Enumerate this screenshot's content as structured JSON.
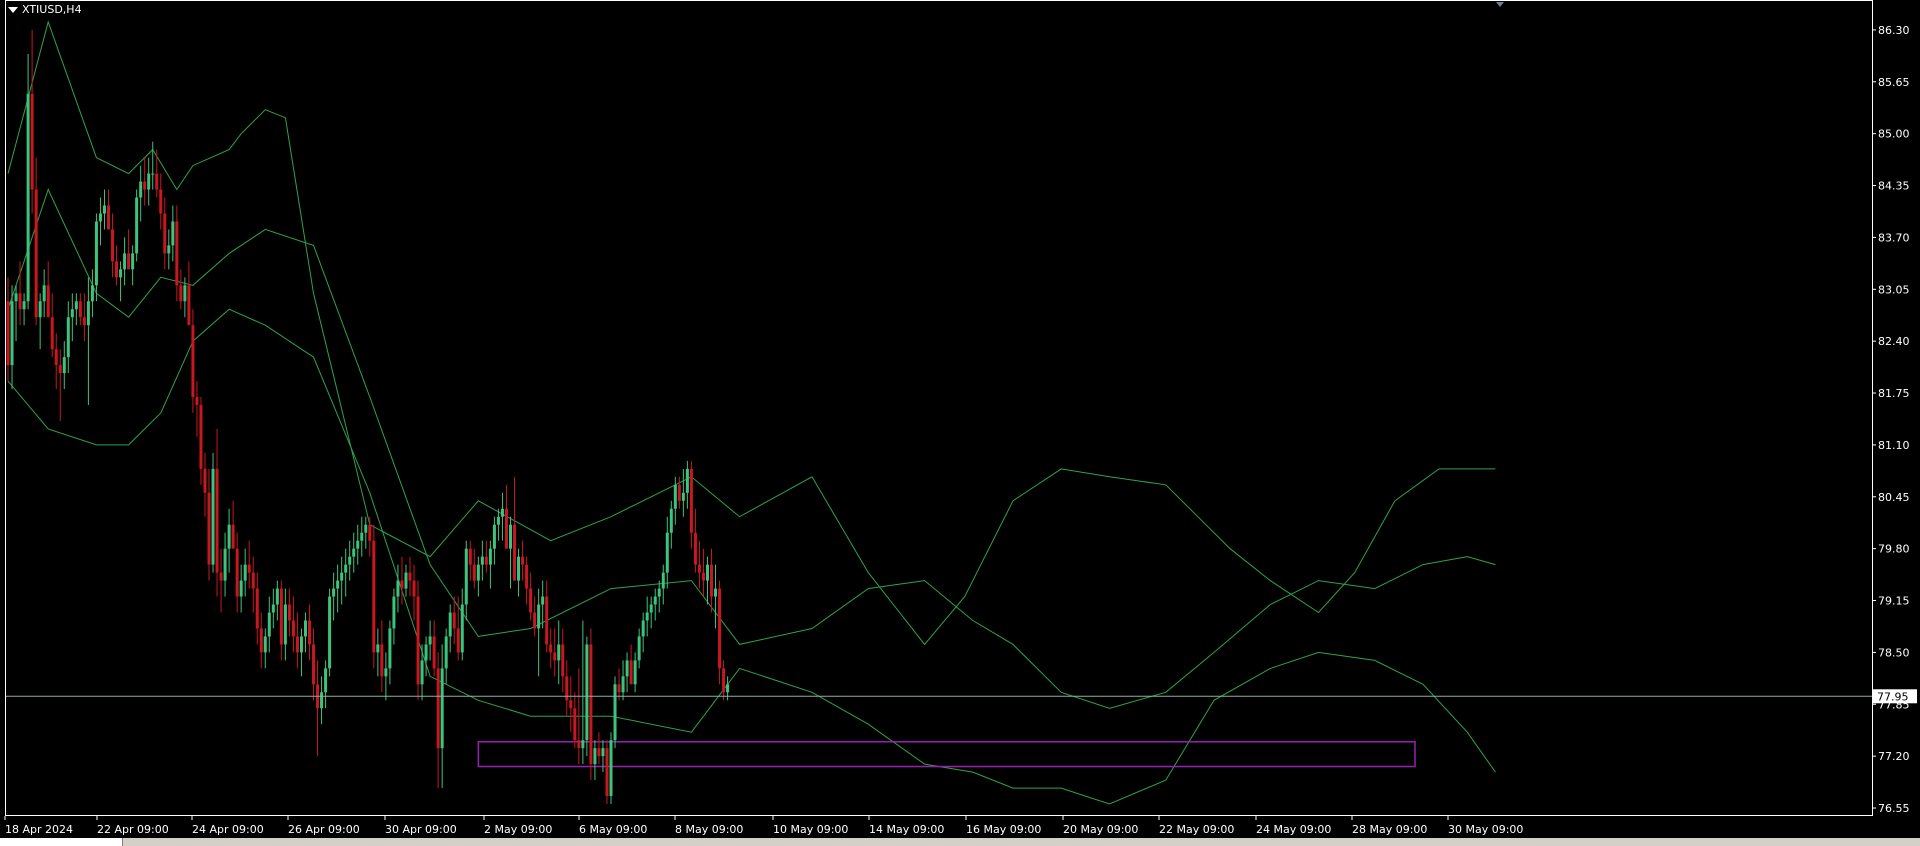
{
  "window": {
    "symbol_title": "XTIUSD,H4"
  },
  "colors": {
    "background": "#000000",
    "frame": "#ffffff",
    "bull": "#3cc47e",
    "bear": "#c8171e",
    "bands": "#2fa34b",
    "price_line": "#8fb0a8",
    "zone": "#9a1fb5",
    "text": "#ffffff"
  },
  "chart_data": {
    "type": "candlestick",
    "symbol": "XTIUSD",
    "timeframe": "H4",
    "x_tick_labels": [
      "18 Apr 2024",
      "22 Apr 09:00",
      "24 Apr 09:00",
      "26 Apr 09:00",
      "30 Apr 09:00",
      "2 May 09:00",
      "6 May 09:00",
      "8 May 09:00",
      "10 May 09:00",
      "14 May 09:00",
      "16 May 09:00",
      "20 May 09:00",
      "22 May 09:00",
      "24 May 09:00",
      "28 May 09:00",
      "30 May 09:00"
    ],
    "y_ticks": [
      86.3,
      85.65,
      85.0,
      84.35,
      83.7,
      83.05,
      82.4,
      81.75,
      81.1,
      80.45,
      79.8,
      79.15,
      78.5,
      77.85,
      77.2,
      76.55
    ],
    "ylim": [
      76.45,
      86.65
    ],
    "current_price": 77.95,
    "current_price_label": "77.95",
    "support_zone": {
      "from_bar": 117,
      "to_bar": 350,
      "low": 77.07,
      "high": 77.38
    },
    "candles": [
      [
        82.9,
        83.2,
        81.9,
        82.1
      ],
      [
        82.1,
        83.1,
        81.8,
        82.9
      ],
      [
        82.9,
        83.1,
        82.4,
        83.0
      ],
      [
        83.0,
        83.4,
        82.6,
        82.8
      ],
      [
        82.8,
        83.0,
        82.6,
        82.9
      ],
      [
        82.9,
        86.0,
        82.8,
        85.5
      ],
      [
        85.5,
        86.3,
        84.0,
        84.3
      ],
      [
        84.3,
        84.7,
        82.6,
        82.7
      ],
      [
        82.7,
        83.0,
        82.3,
        82.9
      ],
      [
        82.9,
        83.3,
        82.7,
        83.1
      ],
      [
        83.1,
        83.4,
        82.8,
        82.7
      ],
      [
        82.7,
        83.0,
        82.2,
        82.3
      ],
      [
        82.3,
        82.5,
        81.8,
        82.1
      ],
      [
        82.1,
        82.3,
        81.4,
        82.0
      ],
      [
        82.0,
        82.4,
        81.8,
        82.2
      ],
      [
        82.2,
        82.9,
        82.0,
        82.7
      ],
      [
        82.7,
        83.0,
        82.4,
        82.8
      ],
      [
        82.8,
        83.0,
        82.6,
        82.9
      ],
      [
        82.9,
        83.0,
        82.6,
        82.7
      ],
      [
        82.7,
        83.0,
        82.4,
        82.6
      ],
      [
        82.6,
        83.2,
        81.6,
        82.9
      ],
      [
        82.9,
        83.3,
        82.7,
        83.1
      ],
      [
        83.1,
        84.0,
        82.9,
        83.9
      ],
      [
        83.9,
        84.2,
        83.6,
        84.0
      ],
      [
        84.0,
        84.3,
        83.8,
        84.1
      ],
      [
        84.1,
        84.3,
        83.8,
        83.8
      ],
      [
        83.8,
        84.0,
        83.2,
        83.4
      ],
      [
        83.4,
        83.6,
        83.1,
        83.2
      ],
      [
        83.2,
        83.4,
        82.9,
        83.3
      ],
      [
        83.3,
        83.7,
        83.1,
        83.5
      ],
      [
        83.5,
        83.8,
        83.3,
        83.3
      ],
      [
        83.3,
        83.6,
        83.1,
        83.5
      ],
      [
        83.5,
        84.3,
        83.4,
        84.2
      ],
      [
        84.2,
        84.6,
        83.9,
        84.4
      ],
      [
        84.4,
        84.7,
        84.1,
        84.3
      ],
      [
        84.3,
        84.7,
        84.1,
        84.5
      ],
      [
        84.5,
        84.9,
        84.3,
        84.5
      ],
      [
        84.5,
        84.8,
        84.2,
        84.3
      ],
      [
        84.3,
        84.5,
        83.8,
        84.0
      ],
      [
        84.0,
        84.2,
        83.3,
        83.5
      ],
      [
        83.5,
        83.8,
        83.3,
        83.6
      ],
      [
        83.6,
        84.1,
        83.4,
        83.9
      ],
      [
        83.9,
        84.1,
        82.9,
        83.1
      ],
      [
        83.1,
        83.3,
        82.8,
        82.9
      ],
      [
        82.9,
        83.2,
        82.7,
        83.1
      ],
      [
        83.1,
        83.4,
        82.8,
        82.6
      ],
      [
        82.6,
        82.8,
        81.5,
        81.7
      ],
      [
        81.7,
        81.9,
        81.2,
        81.6
      ],
      [
        81.6,
        81.7,
        80.6,
        80.8
      ],
      [
        80.8,
        81.0,
        80.2,
        80.5
      ],
      [
        80.5,
        80.8,
        79.4,
        79.6
      ],
      [
        79.6,
        81.0,
        79.5,
        80.8
      ],
      [
        80.8,
        81.3,
        79.2,
        79.5
      ],
      [
        79.5,
        79.8,
        79.0,
        79.4
      ],
      [
        79.4,
        80.0,
        79.2,
        79.8
      ],
      [
        79.8,
        80.3,
        79.5,
        80.1
      ],
      [
        80.1,
        80.4,
        79.9,
        79.8
      ],
      [
        79.8,
        80.0,
        79.0,
        79.2
      ],
      [
        79.2,
        79.6,
        79.0,
        79.4
      ],
      [
        79.4,
        79.8,
        79.2,
        79.6
      ],
      [
        79.6,
        79.9,
        79.3,
        79.5
      ],
      [
        79.5,
        79.7,
        79.0,
        79.3
      ],
      [
        79.3,
        79.5,
        78.6,
        78.8
      ],
      [
        78.8,
        79.0,
        78.3,
        78.5
      ],
      [
        78.5,
        78.8,
        78.3,
        78.7
      ],
      [
        78.7,
        79.2,
        78.5,
        79.0
      ],
      [
        79.0,
        79.3,
        78.8,
        79.1
      ],
      [
        79.1,
        79.4,
        78.9,
        79.3
      ],
      [
        79.3,
        79.4,
        78.4,
        78.6
      ],
      [
        78.6,
        79.3,
        78.4,
        79.1
      ],
      [
        79.1,
        79.3,
        78.7,
        78.9
      ],
      [
        78.9,
        79.2,
        78.5,
        78.7
      ],
      [
        78.7,
        79.0,
        78.3,
        78.5
      ],
      [
        78.5,
        78.8,
        78.2,
        78.7
      ],
      [
        78.7,
        79.0,
        78.5,
        78.9
      ],
      [
        78.9,
        79.1,
        78.4,
        78.6
      ],
      [
        78.6,
        78.8,
        77.9,
        78.1
      ],
      [
        78.1,
        78.4,
        77.2,
        77.8
      ],
      [
        77.8,
        78.2,
        77.6,
        78.0
      ],
      [
        78.0,
        78.4,
        77.8,
        78.3
      ],
      [
        78.3,
        79.3,
        78.2,
        79.2
      ],
      [
        79.2,
        79.5,
        78.9,
        79.3
      ],
      [
        79.3,
        79.6,
        79.0,
        79.4
      ],
      [
        79.4,
        79.7,
        79.1,
        79.5
      ],
      [
        79.5,
        79.8,
        79.2,
        79.6
      ],
      [
        79.6,
        79.9,
        79.4,
        79.7
      ],
      [
        79.7,
        80.0,
        79.5,
        79.8
      ],
      [
        79.8,
        80.1,
        79.6,
        79.9
      ],
      [
        79.9,
        80.2,
        79.7,
        80.0
      ],
      [
        80.0,
        80.2,
        79.8,
        80.1
      ],
      [
        80.1,
        80.2,
        79.7,
        79.9
      ],
      [
        79.9,
        80.1,
        78.3,
        78.5
      ],
      [
        78.5,
        78.8,
        78.2,
        78.6
      ],
      [
        78.6,
        78.9,
        78.0,
        78.2
      ],
      [
        78.2,
        78.5,
        77.9,
        78.3
      ],
      [
        78.3,
        78.9,
        78.1,
        78.8
      ],
      [
        78.8,
        79.3,
        78.6,
        79.2
      ],
      [
        79.2,
        79.6,
        79.0,
        79.4
      ],
      [
        79.4,
        79.7,
        79.1,
        79.3
      ],
      [
        79.3,
        79.6,
        79.2,
        79.5
      ],
      [
        79.5,
        79.7,
        79.2,
        79.4
      ],
      [
        79.4,
        79.6,
        78.9,
        79.2
      ],
      [
        79.2,
        79.4,
        77.9,
        78.1
      ],
      [
        78.1,
        78.6,
        77.9,
        78.4
      ],
      [
        78.4,
        78.7,
        78.2,
        78.6
      ],
      [
        78.6,
        78.9,
        78.4,
        78.7
      ],
      [
        78.7,
        78.9,
        78.2,
        78.3
      ],
      [
        78.3,
        78.5,
        76.8,
        77.3
      ],
      [
        77.3,
        78.6,
        76.8,
        78.3
      ],
      [
        78.3,
        78.8,
        78.1,
        78.7
      ],
      [
        78.7,
        79.1,
        78.5,
        79.0
      ],
      [
        79.0,
        79.2,
        78.6,
        78.8
      ],
      [
        78.8,
        79.2,
        78.4,
        78.5
      ],
      [
        78.5,
        79.3,
        78.4,
        79.1
      ],
      [
        79.1,
        79.9,
        78.9,
        79.8
      ],
      [
        79.8,
        79.9,
        79.4,
        79.6
      ],
      [
        79.6,
        79.8,
        79.3,
        79.4
      ],
      [
        79.4,
        79.7,
        79.2,
        79.6
      ],
      [
        79.6,
        79.9,
        79.4,
        79.7
      ],
      [
        79.7,
        79.9,
        79.5,
        79.6
      ],
      [
        79.6,
        79.9,
        79.3,
        79.8
      ],
      [
        79.8,
        80.2,
        79.6,
        80.1
      ],
      [
        80.1,
        80.3,
        79.9,
        80.2
      ],
      [
        80.2,
        80.5,
        79.9,
        80.3
      ],
      [
        80.3,
        80.6,
        80.0,
        79.8
      ],
      [
        79.8,
        80.2,
        79.3,
        80.1
      ],
      [
        80.1,
        80.7,
        79.8,
        79.4
      ],
      [
        79.4,
        79.8,
        79.2,
        79.7
      ],
      [
        79.7,
        79.9,
        79.4,
        79.6
      ],
      [
        79.6,
        79.7,
        79.1,
        79.3
      ],
      [
        79.3,
        79.5,
        78.9,
        79.0
      ],
      [
        79.0,
        79.2,
        78.7,
        78.8
      ],
      [
        78.8,
        79.3,
        78.2,
        79.1
      ],
      [
        79.1,
        79.4,
        78.8,
        79.2
      ],
      [
        79.2,
        79.4,
        78.5,
        78.6
      ],
      [
        78.6,
        78.8,
        78.3,
        78.5
      ],
      [
        78.5,
        78.8,
        78.2,
        78.4
      ],
      [
        78.4,
        78.9,
        78.1,
        78.6
      ],
      [
        78.6,
        78.8,
        78.0,
        78.2
      ],
      [
        78.2,
        78.4,
        77.7,
        77.9
      ],
      [
        77.9,
        78.2,
        77.5,
        77.8
      ],
      [
        77.8,
        78.0,
        77.3,
        77.4
      ],
      [
        77.4,
        78.3,
        77.1,
        77.3
      ],
      [
        77.3,
        78.9,
        77.1,
        77.4
      ],
      [
        77.4,
        78.7,
        77.2,
        78.6
      ],
      [
        78.6,
        78.8,
        76.9,
        77.1
      ],
      [
        77.1,
        77.4,
        76.9,
        77.3
      ],
      [
        77.3,
        77.5,
        77.1,
        77.2
      ],
      [
        77.2,
        77.4,
        77.0,
        77.3
      ],
      [
        77.3,
        77.4,
        76.6,
        76.7
      ],
      [
        76.7,
        77.5,
        76.6,
        77.4
      ],
      [
        77.4,
        78.2,
        77.3,
        78.1
      ],
      [
        78.1,
        78.3,
        77.9,
        78.0
      ],
      [
        78.0,
        78.4,
        77.9,
        78.2
      ],
      [
        78.2,
        78.5,
        78.0,
        78.4
      ],
      [
        78.4,
        78.6,
        78.2,
        78.1
      ],
      [
        78.1,
        78.5,
        78.0,
        78.4
      ],
      [
        78.4,
        78.8,
        78.3,
        78.7
      ],
      [
        78.7,
        79.0,
        78.5,
        78.9
      ],
      [
        78.9,
        79.2,
        78.7,
        79.0
      ],
      [
        79.0,
        79.2,
        78.8,
        79.1
      ],
      [
        79.1,
        79.3,
        78.9,
        79.2
      ],
      [
        79.2,
        79.4,
        79.0,
        79.3
      ],
      [
        79.3,
        79.6,
        79.1,
        79.5
      ],
      [
        79.5,
        80.2,
        79.3,
        80.0
      ],
      [
        80.0,
        80.4,
        79.8,
        80.3
      ],
      [
        80.3,
        80.7,
        80.1,
        80.6
      ],
      [
        80.6,
        80.7,
        80.3,
        80.4
      ],
      [
        80.4,
        80.8,
        80.2,
        80.5
      ],
      [
        80.5,
        80.9,
        80.3,
        80.8
      ],
      [
        80.8,
        80.9,
        79.8,
        80.0
      ],
      [
        80.0,
        80.3,
        79.5,
        79.6
      ],
      [
        79.6,
        79.9,
        79.3,
        79.5
      ],
      [
        79.5,
        79.8,
        79.2,
        79.4
      ],
      [
        79.4,
        79.7,
        79.1,
        79.6
      ],
      [
        79.6,
        79.8,
        79.0,
        79.2
      ],
      [
        79.2,
        79.6,
        78.8,
        79.3
      ],
      [
        79.3,
        79.4,
        78.1,
        78.3
      ],
      [
        78.3,
        78.4,
        77.9,
        78.0
      ],
      [
        78.0,
        78.2,
        77.9,
        78.1
      ]
    ],
    "bollinger_bands": {
      "upper": [
        [
          0,
          84.5
        ],
        [
          10,
          86.4
        ],
        [
          22,
          84.7
        ],
        [
          30,
          84.5
        ],
        [
          36,
          84.8
        ],
        [
          42,
          84.3
        ],
        [
          46,
          84.6
        ],
        [
          55,
          84.8
        ],
        [
          58,
          85.0
        ],
        [
          64,
          85.3
        ],
        [
          69,
          85.2
        ],
        [
          76,
          83.0
        ],
        [
          90,
          80.1
        ],
        [
          105,
          79.7
        ],
        [
          117,
          80.4
        ],
        [
          135,
          79.9
        ],
        [
          150,
          80.2
        ],
        [
          170,
          80.7
        ],
        [
          182,
          80.2
        ],
        [
          200,
          80.7
        ],
        [
          214,
          79.5
        ],
        [
          228,
          78.6
        ],
        [
          238,
          79.2
        ],
        [
          250,
          80.4
        ],
        [
          262,
          80.8
        ],
        [
          274,
          80.7
        ],
        [
          288,
          80.6
        ],
        [
          294,
          80.3
        ],
        [
          304,
          79.8
        ],
        [
          314,
          79.4
        ],
        [
          326,
          79.0
        ],
        [
          335,
          79.5
        ],
        [
          345,
          80.4
        ],
        [
          356,
          80.8
        ],
        [
          363,
          80.8
        ],
        [
          370,
          80.8
        ]
      ],
      "middle": [
        [
          0,
          82.8
        ],
        [
          10,
          84.3
        ],
        [
          22,
          83.0
        ],
        [
          30,
          82.7
        ],
        [
          38,
          83.2
        ],
        [
          46,
          83.1
        ],
        [
          55,
          83.5
        ],
        [
          64,
          83.8
        ],
        [
          76,
          83.6
        ],
        [
          90,
          81.7
        ],
        [
          105,
          79.6
        ],
        [
          117,
          78.7
        ],
        [
          130,
          78.8
        ],
        [
          150,
          79.3
        ],
        [
          170,
          79.4
        ],
        [
          182,
          78.6
        ],
        [
          200,
          78.8
        ],
        [
          214,
          79.3
        ],
        [
          228,
          79.4
        ],
        [
          240,
          78.9
        ],
        [
          250,
          78.6
        ],
        [
          262,
          78.0
        ],
        [
          274,
          77.8
        ],
        [
          288,
          78.0
        ],
        [
          300,
          78.5
        ],
        [
          314,
          79.1
        ],
        [
          326,
          79.4
        ],
        [
          340,
          79.3
        ],
        [
          352,
          79.6
        ],
        [
          363,
          79.7
        ],
        [
          370,
          79.6
        ]
      ],
      "lower": [
        [
          0,
          81.9
        ],
        [
          10,
          81.3
        ],
        [
          22,
          81.1
        ],
        [
          30,
          81.1
        ],
        [
          38,
          81.5
        ],
        [
          46,
          82.4
        ],
        [
          55,
          82.8
        ],
        [
          64,
          82.6
        ],
        [
          76,
          82.2
        ],
        [
          90,
          80.5
        ],
        [
          105,
          78.2
        ],
        [
          117,
          77.9
        ],
        [
          130,
          77.7
        ],
        [
          150,
          77.7
        ],
        [
          170,
          77.5
        ],
        [
          182,
          78.3
        ],
        [
          200,
          78.0
        ],
        [
          214,
          77.6
        ],
        [
          228,
          77.1
        ],
        [
          240,
          77.0
        ],
        [
          250,
          76.8
        ],
        [
          262,
          76.8
        ],
        [
          274,
          76.6
        ],
        [
          288,
          76.9
        ],
        [
          300,
          77.9
        ],
        [
          314,
          78.3
        ],
        [
          326,
          78.5
        ],
        [
          340,
          78.4
        ],
        [
          352,
          78.1
        ],
        [
          363,
          77.5
        ],
        [
          370,
          77.0
        ]
      ]
    }
  }
}
